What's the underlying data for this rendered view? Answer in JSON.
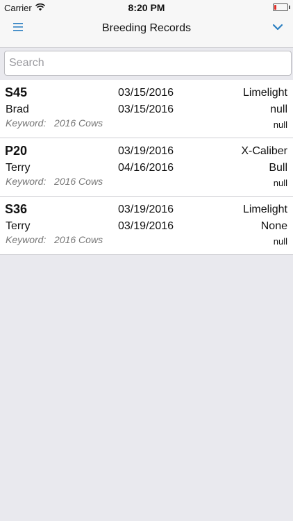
{
  "status_bar": {
    "carrier": "Carrier",
    "time": "8:20 PM",
    "battery_level": 0.15,
    "battery_color": "#e0302a"
  },
  "nav": {
    "title": "Breeding Records",
    "menu_icon": "hamburger-icon",
    "right_icon": "chevron-down-icon",
    "accent": "#2b7fc1"
  },
  "search": {
    "placeholder": "Search",
    "value": ""
  },
  "records": [
    {
      "code": "S45",
      "name": "Brad",
      "keyword": "Keyword:   2016 Cows",
      "date1": "03/15/2016",
      "date2": "03/15/2016",
      "sire": "Limelight",
      "type": "null",
      "extra": "null"
    },
    {
      "code": "P20",
      "name": "Terry",
      "keyword": "Keyword:   2016 Cows",
      "date1": "03/19/2016",
      "date2": "04/16/2016",
      "sire": "X-Caliber",
      "type": "Bull",
      "extra": "null"
    },
    {
      "code": "S36",
      "name": "Terry",
      "keyword": "Keyword:   2016 Cows",
      "date1": "03/19/2016",
      "date2": "03/19/2016",
      "sire": "Limelight",
      "type": "None",
      "extra": "null"
    }
  ]
}
